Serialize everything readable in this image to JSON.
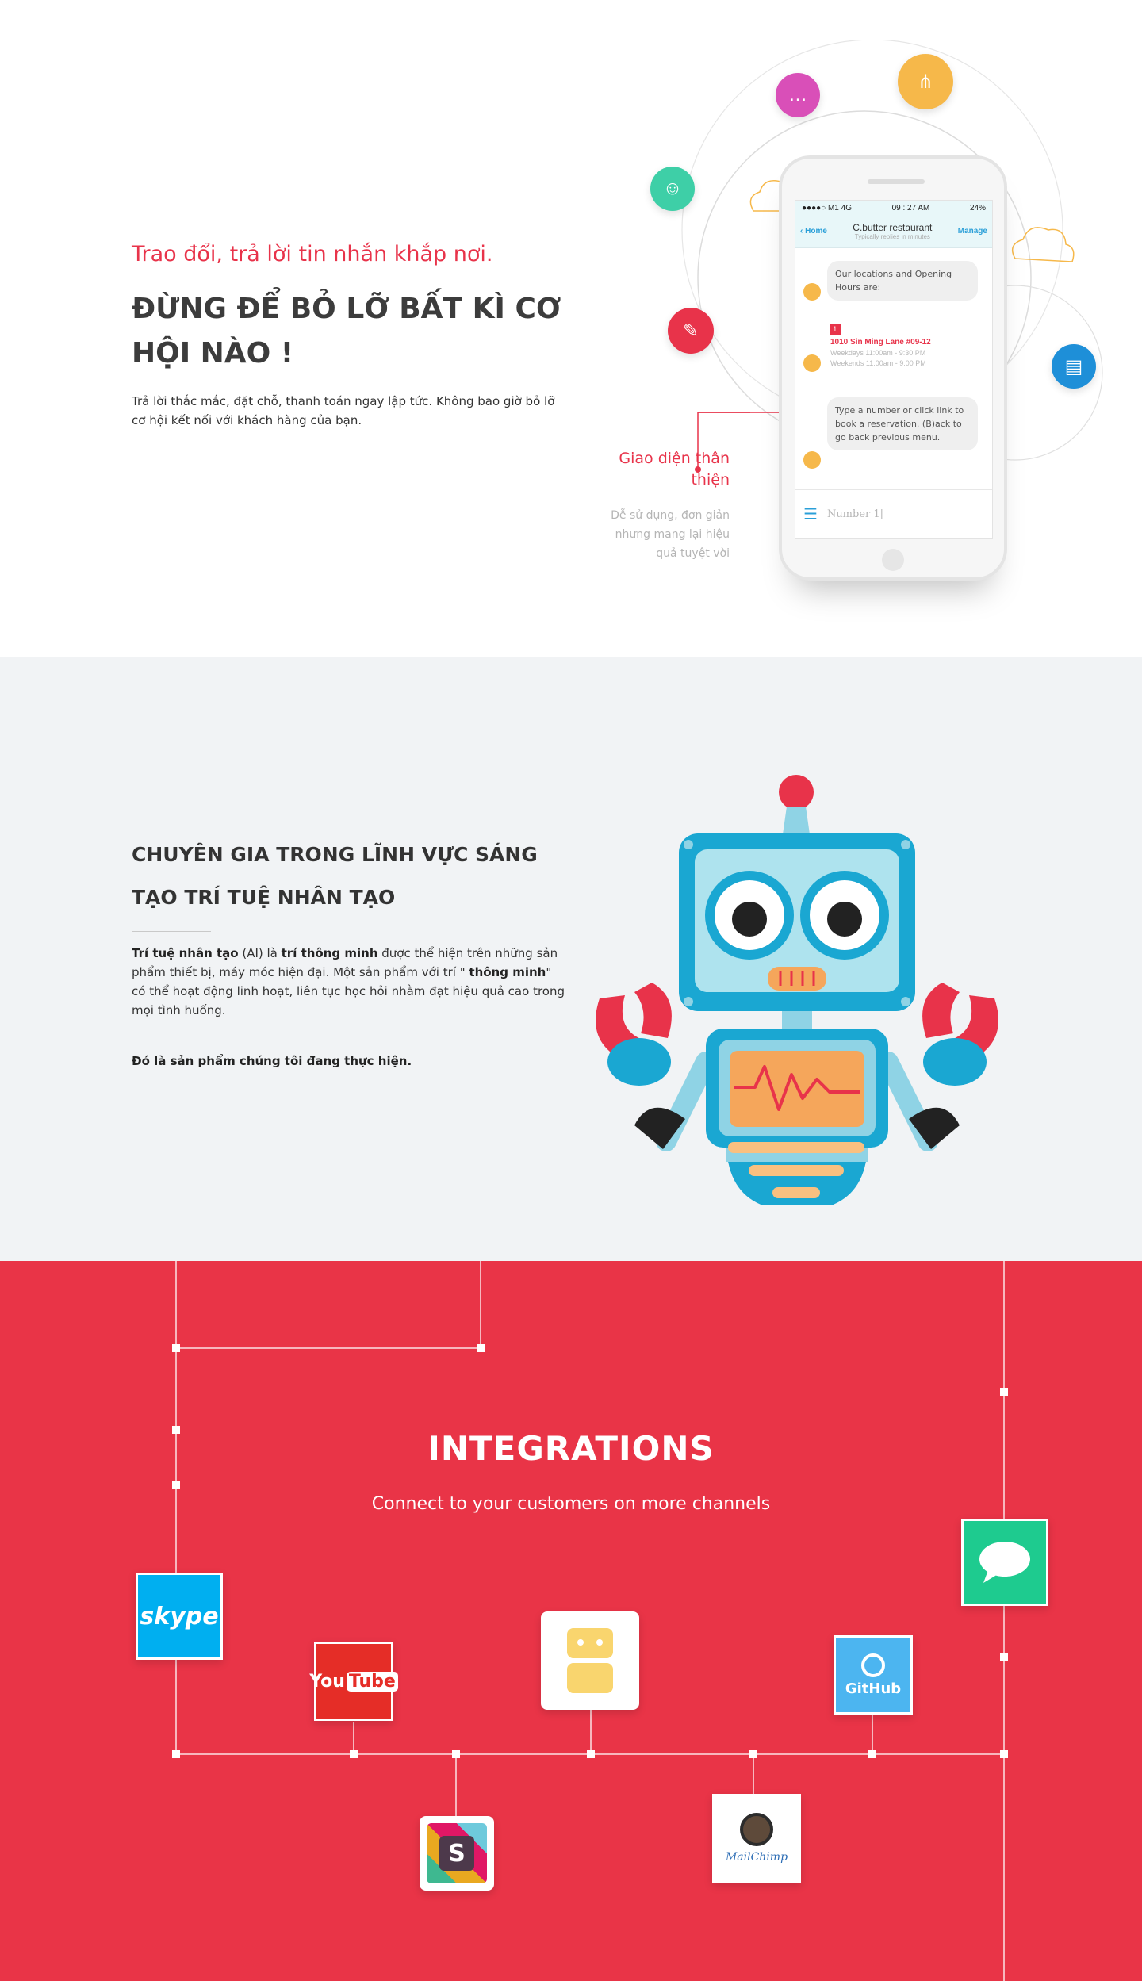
{
  "messaging": {
    "tagline": "Trao đổi, trả lời tin nhắn khắp nơi.",
    "heading": "ĐỪNG ĐỂ BỎ LỠ BẤT KÌ CƠ HỘI NÀO !",
    "body": "Trả lời thắc mắc, đặt chỗ, thanh toán ngay lập tức. Không bao giờ bỏ lỡ cơ hội kết nối với khách hàng của bạn.",
    "callout_title": "Giao diện thân thiện",
    "callout_desc": "Dễ sử dụng, đơn giản nhưng mang lại hiệu quả tuyệt vời"
  },
  "phone": {
    "status_left": "●●●●○ M1  4G",
    "status_time": "09 : 27 AM",
    "status_battery": "24%",
    "nav_back": "‹ Home",
    "nav_title": "C.butter restaurant",
    "nav_subtitle": "Typically replies in minutes",
    "nav_manage": "Manage",
    "bubble1": "Our locations and Opening Hours are:",
    "card_number": "1.",
    "card_title": "1010 Sin Ming Lane #09-12",
    "card_weekdays": "Weekdays 11:00am - 9:30 PM",
    "card_weekends": "Weekends 11:00am - 9:00 PM",
    "bubble2": "Type a number or click link to book a reservation. (B)ack to go back previous menu.",
    "input_value": "Number 1|"
  },
  "ai": {
    "heading": "CHUYÊN GIA TRONG LĨNH VỰC SÁNG TẠO TRÍ TUỆ NHÂN TẠO",
    "body_bold1": "Trí tuệ nhân tạo",
    "body_text1": " (AI) là ",
    "body_bold2": "trí thông minh",
    "body_text2": " được thể hiện trên những sản phẩm thiết bị, máy móc hiện đại. Một sản phẩm với trí \" ",
    "body_bold3": "thông minh",
    "body_text3": "\" có thể hoạt động linh hoạt, liên tục học hỏi nhằm đạt hiệu quả cao trong mọi tình huống.",
    "footer": "Đó là sản phẩm chúng tôi đang thực hiện."
  },
  "integrations": {
    "title": "INTEGRATIONS",
    "subtitle": "Connect to your customers on more channels",
    "logos": {
      "skype": "skype",
      "youtube_you": "You",
      "youtube_tube": "Tube",
      "slack": "S",
      "github": "GitHub",
      "mailchimp": "MailChimp"
    }
  },
  "colors": {
    "brand_red": "#e8334a",
    "robot_blue": "#1aa7d2",
    "integration_bg": "#e93447"
  }
}
